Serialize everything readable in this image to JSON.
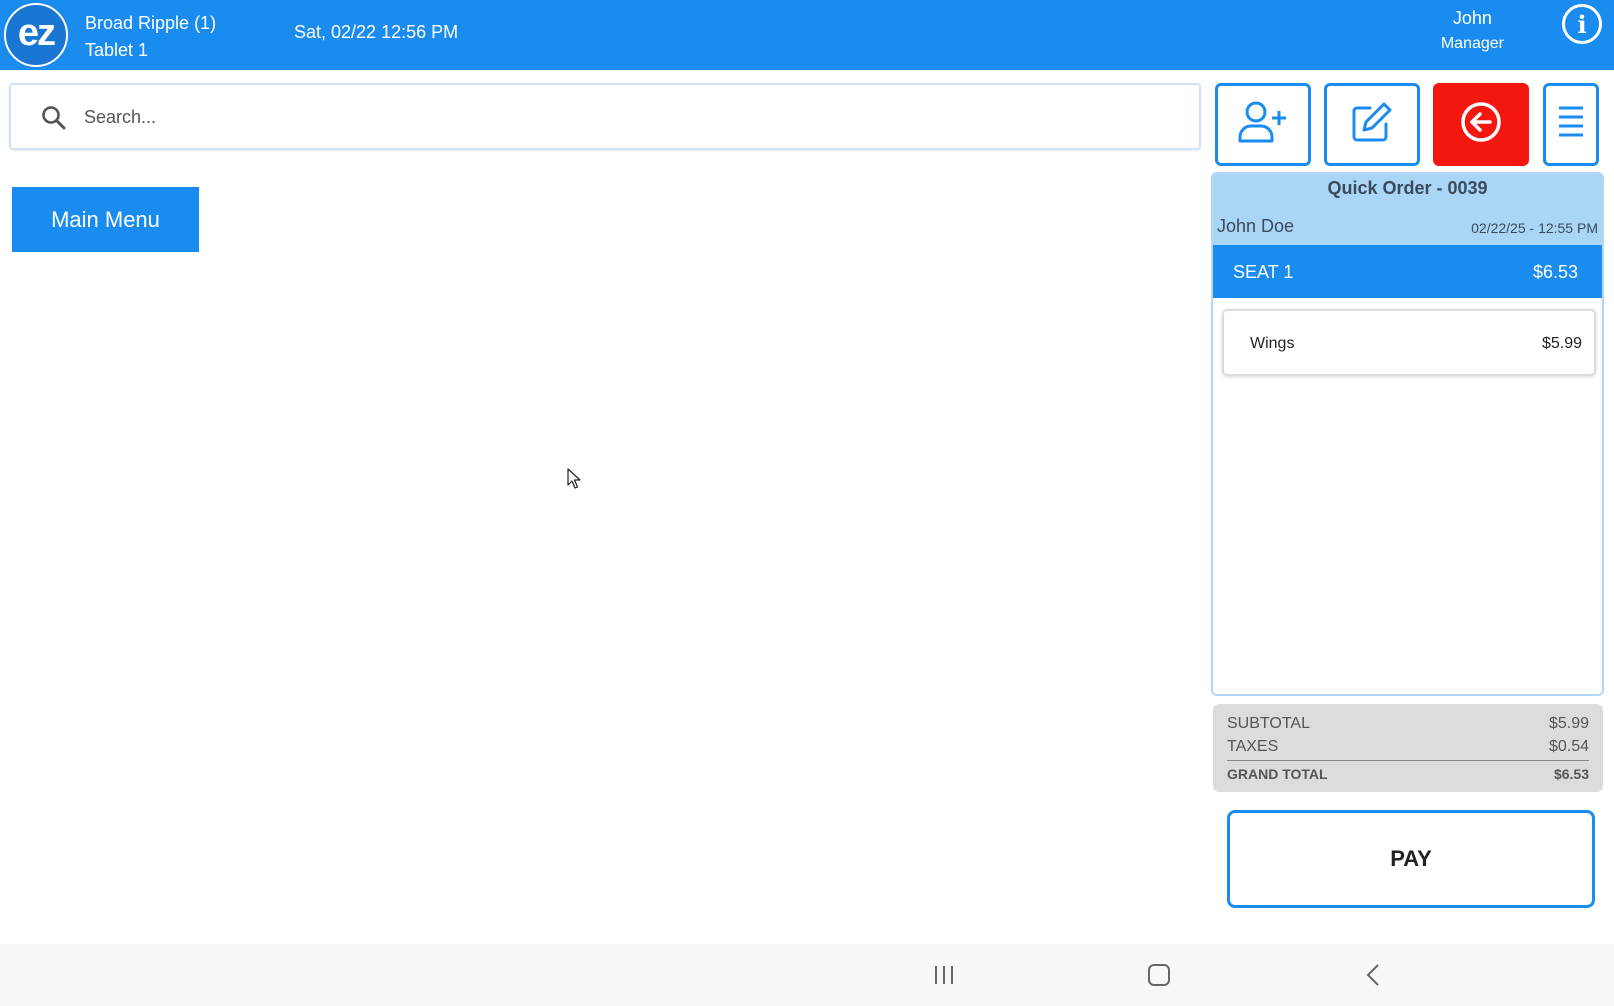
{
  "header": {
    "logo_text": "ez",
    "store_name": "Broad Ripple (1)",
    "device": "Tablet 1",
    "datetime": "Sat, 02/22 12:56 PM",
    "user_name": "John",
    "user_role": "Manager",
    "info_glyph": "i",
    "color": "#1a8cf0"
  },
  "search": {
    "placeholder": "Search...",
    "value": ""
  },
  "actions": {
    "icons": [
      "add-user-icon",
      "edit-icon",
      "back-arrow-icon",
      "menu-icon"
    ],
    "exit_color": "#f5160f"
  },
  "main_menu": {
    "label": "Main Menu"
  },
  "order": {
    "title": "Quick Order - 0039",
    "customer": "John Doe",
    "timestamp": "02/22/25  - 12:55 PM",
    "seat": {
      "label": "SEAT 1",
      "total": "$6.53"
    },
    "items": [
      {
        "name": "Wings",
        "price": "$5.99"
      }
    ]
  },
  "totals": {
    "subtotal_label": "SUBTOTAL",
    "subtotal": "$5.99",
    "taxes_label": "TAXES",
    "taxes": "$0.54",
    "grand_label": "GRAND TOTAL",
    "grand": "$6.53"
  },
  "pay": {
    "label": "PAY"
  },
  "navbar": {
    "icons": [
      "recent-apps-icon",
      "home-icon",
      "back-icon"
    ]
  }
}
